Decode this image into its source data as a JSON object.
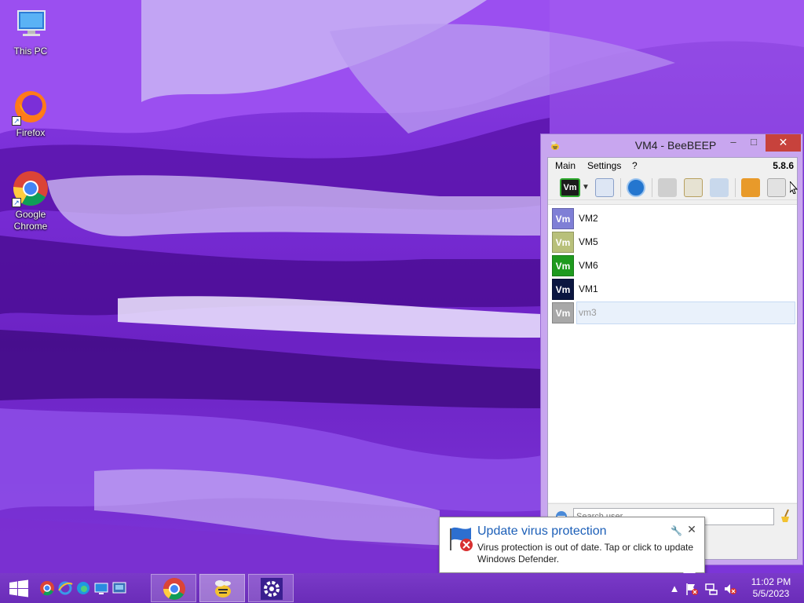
{
  "desktop": {
    "icons": [
      {
        "label": "This PC",
        "icon": "this-pc-icon"
      },
      {
        "label": "Firefox",
        "icon": "firefox-icon"
      },
      {
        "label": "Google Chrome",
        "icon": "chrome-icon"
      }
    ]
  },
  "window": {
    "title": "VM4 - BeeBEEP",
    "buttons": {
      "minimize": "–",
      "maximize": "□",
      "close": "✕"
    },
    "menu": {
      "main": "Main",
      "settings": "Settings",
      "help": "?",
      "version": "5.8.6"
    },
    "toolbar": {
      "status_avatar": "Vm"
    },
    "users": [
      {
        "avatar": "Vm",
        "name": "VM2",
        "color": "#7f7fd6"
      },
      {
        "avatar": "Vm",
        "name": "VM5",
        "color": "#b8c07a"
      },
      {
        "avatar": "Vm",
        "name": "VM6",
        "color": "#1e9a1e"
      },
      {
        "avatar": "Vm",
        "name": "VM1",
        "color": "#0b1640"
      },
      {
        "avatar": "Vm",
        "name": "vm3",
        "color": "#a8a8a8",
        "selected": true
      }
    ],
    "search": {
      "placeholder": "Search user"
    }
  },
  "toast": {
    "title": "Update virus protection",
    "body": "Virus protection is out of date. Tap or click to update Windows Defender.",
    "wrench": "🔧",
    "close": "✕"
  },
  "taskbar": {
    "clock_time": "11:02 PM",
    "clock_date": "5/5/2023"
  },
  "colors": {
    "accent": "#c8a6ef",
    "close": "#c7423c",
    "toast_title": "#1c5fb8"
  }
}
